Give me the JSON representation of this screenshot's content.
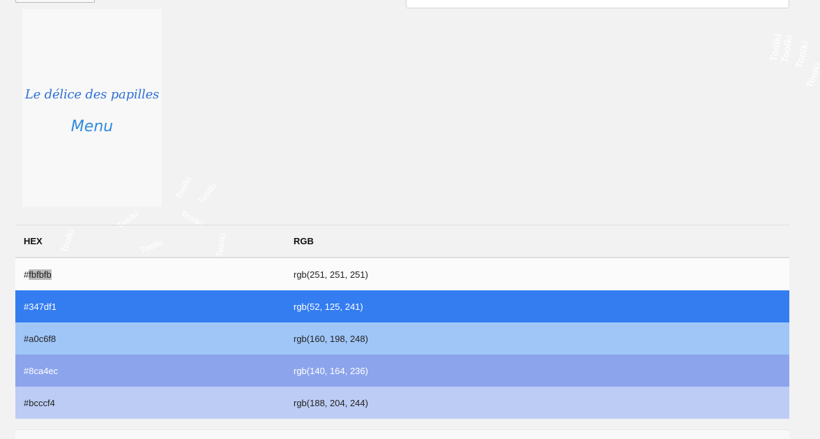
{
  "preview": {
    "title": "Le délice des papilles",
    "subtitle": "Menu"
  },
  "watermark": "Toolki",
  "table": {
    "headers": {
      "hex": "HEX",
      "rgb": "RGB"
    },
    "rows": [
      {
        "hex_prefix": "#",
        "hex_value": "fbfbfb",
        "rgb": "rgb(251, 251, 251)",
        "color": "#fbfbfb",
        "text_color": "#222222"
      },
      {
        "hex_prefix": "#",
        "hex_value": "347df1",
        "rgb": "rgb(52, 125, 241)",
        "color": "#347df1",
        "text_color": "#ffffff"
      },
      {
        "hex_prefix": "#",
        "hex_value": "a0c6f8",
        "rgb": "rgb(160, 198, 248)",
        "color": "#a0c6f8",
        "text_color": "#222222"
      },
      {
        "hex_prefix": "#",
        "hex_value": "8ca4ec",
        "rgb": "rgb(140, 164, 236)",
        "color": "#8ca4ec",
        "text_color": "#ffffff"
      },
      {
        "hex_prefix": "#",
        "hex_value": "bcccf4",
        "rgb": "rgb(188, 204, 244)",
        "color": "#bcccf4",
        "text_color": "#222222"
      }
    ]
  }
}
